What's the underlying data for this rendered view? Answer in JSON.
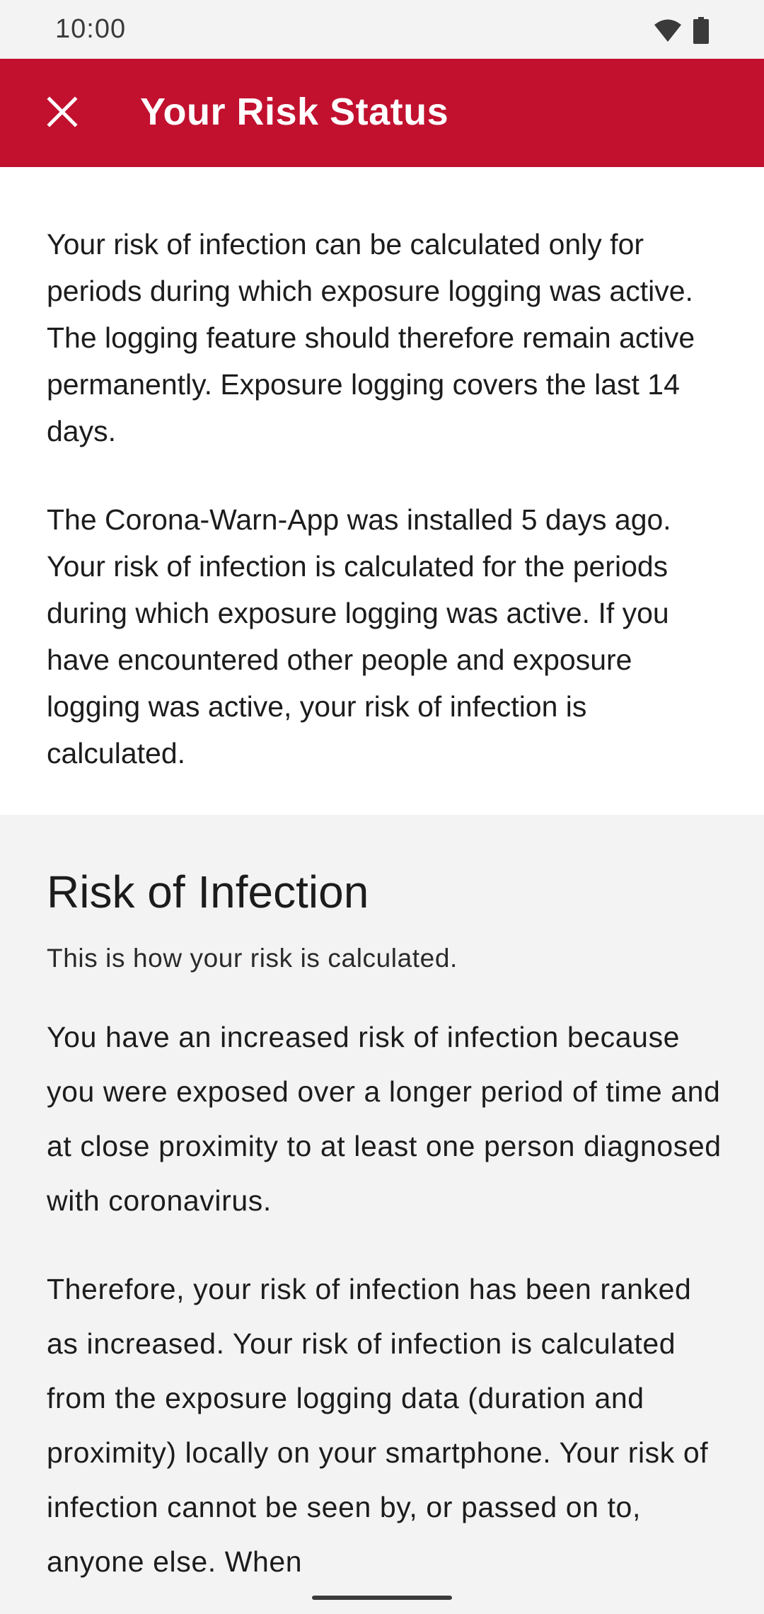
{
  "status_bar": {
    "time": "10:00",
    "icons": [
      "wifi-icon",
      "battery-icon"
    ]
  },
  "app_bar": {
    "close_icon": "close-icon",
    "title": "Your Risk Status",
    "color": "#c2102f"
  },
  "content": {
    "paragraph_1": "Your risk of infection can be calculated only for periods during which exposure logging was active. The logging feature should therefore remain active permanently. Exposure logging covers the last 14 days.",
    "paragraph_2": "The Corona-Warn-App was installed 5 days ago. Your risk of infection is calculated for the periods during which exposure logging was active. If you have encountered other people and exposure logging was active, your risk of infection is calculated.",
    "risk_section": {
      "title": "Risk of Infection",
      "subtitle": "This is how your risk is calculated.",
      "paragraph_1": "You have an increased risk of infection because you were exposed over a longer period of time and at close proximity to at least one person diagnosed with coronavirus.",
      "paragraph_2": "Therefore, your risk of infection has been ranked as increased. Your risk of infection is calculated from the exposure logging data (duration and proximity) locally on your smartphone. Your risk of infection cannot be seen by, or passed on to, anyone else. When"
    }
  }
}
